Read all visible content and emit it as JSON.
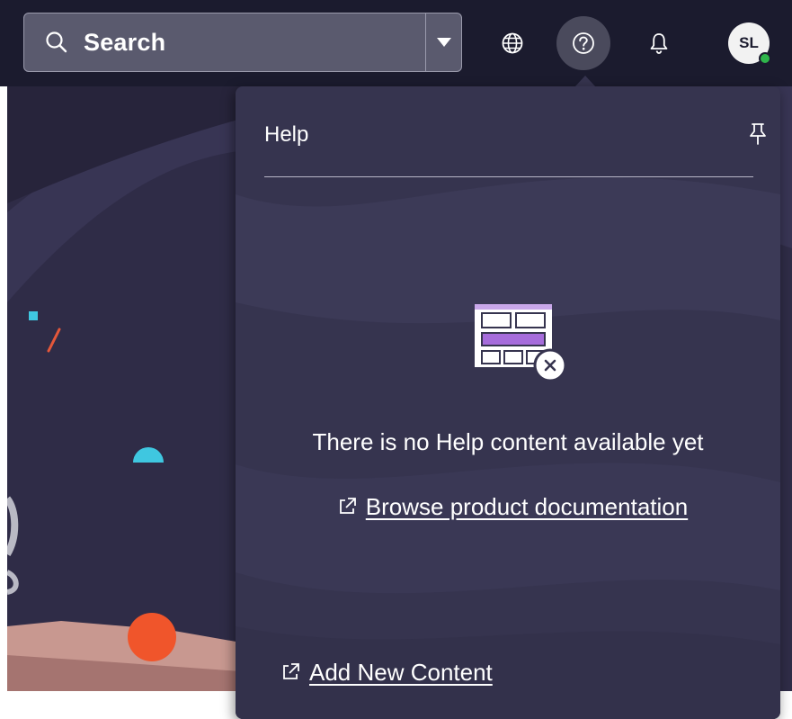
{
  "topbar": {
    "search": {
      "placeholder": "Search"
    },
    "icons": {
      "search": "search-icon",
      "dropdown": "caret-down-icon",
      "language": "globe-icon",
      "help": "question-circle-icon",
      "notifications": "bell-icon"
    },
    "avatar": {
      "initials": "SL",
      "status_color": "#2fb54b"
    }
  },
  "help_panel": {
    "title": "Help",
    "pin_icon": "pin-icon",
    "empty_state": {
      "illustration": "empty-layout-illustration",
      "message": "There is no Help content available yet"
    },
    "browse_link": {
      "label": "Browse product documentation",
      "icon": "external-link-icon"
    },
    "add_link": {
      "label": "Add New Content",
      "icon": "external-link-icon"
    }
  },
  "colors": {
    "topbar_bg": "#1b1b2e",
    "panel_bg": "#36344f",
    "accent_purple": "#a66cdb",
    "accent_cyan": "#3fc7e0",
    "accent_orange": "#f0552b"
  }
}
